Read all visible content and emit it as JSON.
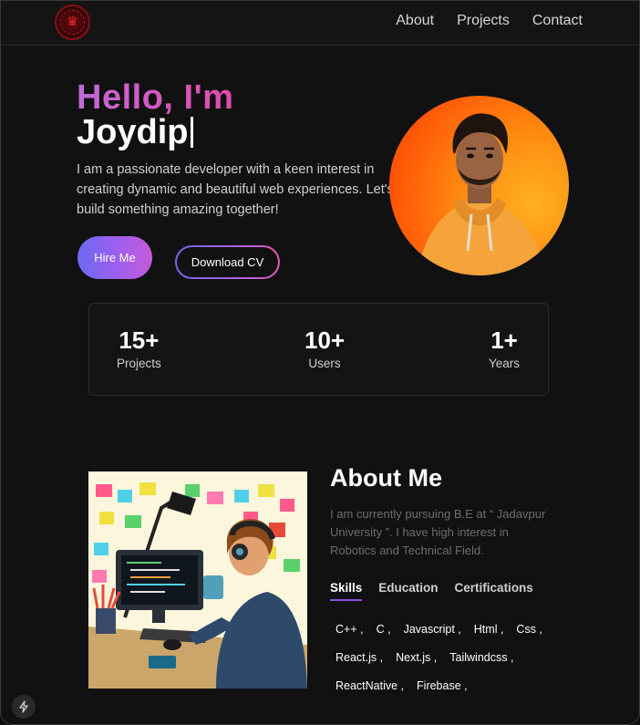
{
  "nav": {
    "links": [
      "About",
      "Projects",
      "Contact"
    ]
  },
  "hero": {
    "greeting": "Hello, I'm",
    "name": "Joydip",
    "intro": "I am a passionate developer with a keen interest in creating dynamic and beautiful web experiences. Let's build something amazing together!",
    "hire_label": "Hire Me",
    "cv_label": "Download CV"
  },
  "stats": [
    {
      "value": "15+",
      "label": "Projects"
    },
    {
      "value": "10+",
      "label": "Users"
    },
    {
      "value": "1+",
      "label": "Years"
    }
  ],
  "about": {
    "title": "About Me",
    "text": "I am currently pursuing B.E at “ Jadavpur University ”. I have high interest in Robotics and Technical Field.",
    "tabs": [
      "Skills",
      "Education",
      "Certifications"
    ],
    "skills": [
      "C++ ,",
      "C ,",
      "Javascript ,",
      "Html ,",
      "Css ,",
      "React.js ,",
      "Next.js ,",
      "Tailwindcss ,",
      "ReactNative ,",
      "Firebase ,"
    ]
  },
  "icons": {
    "logo": "crown-logo-icon",
    "floating": "bolt-icon"
  }
}
